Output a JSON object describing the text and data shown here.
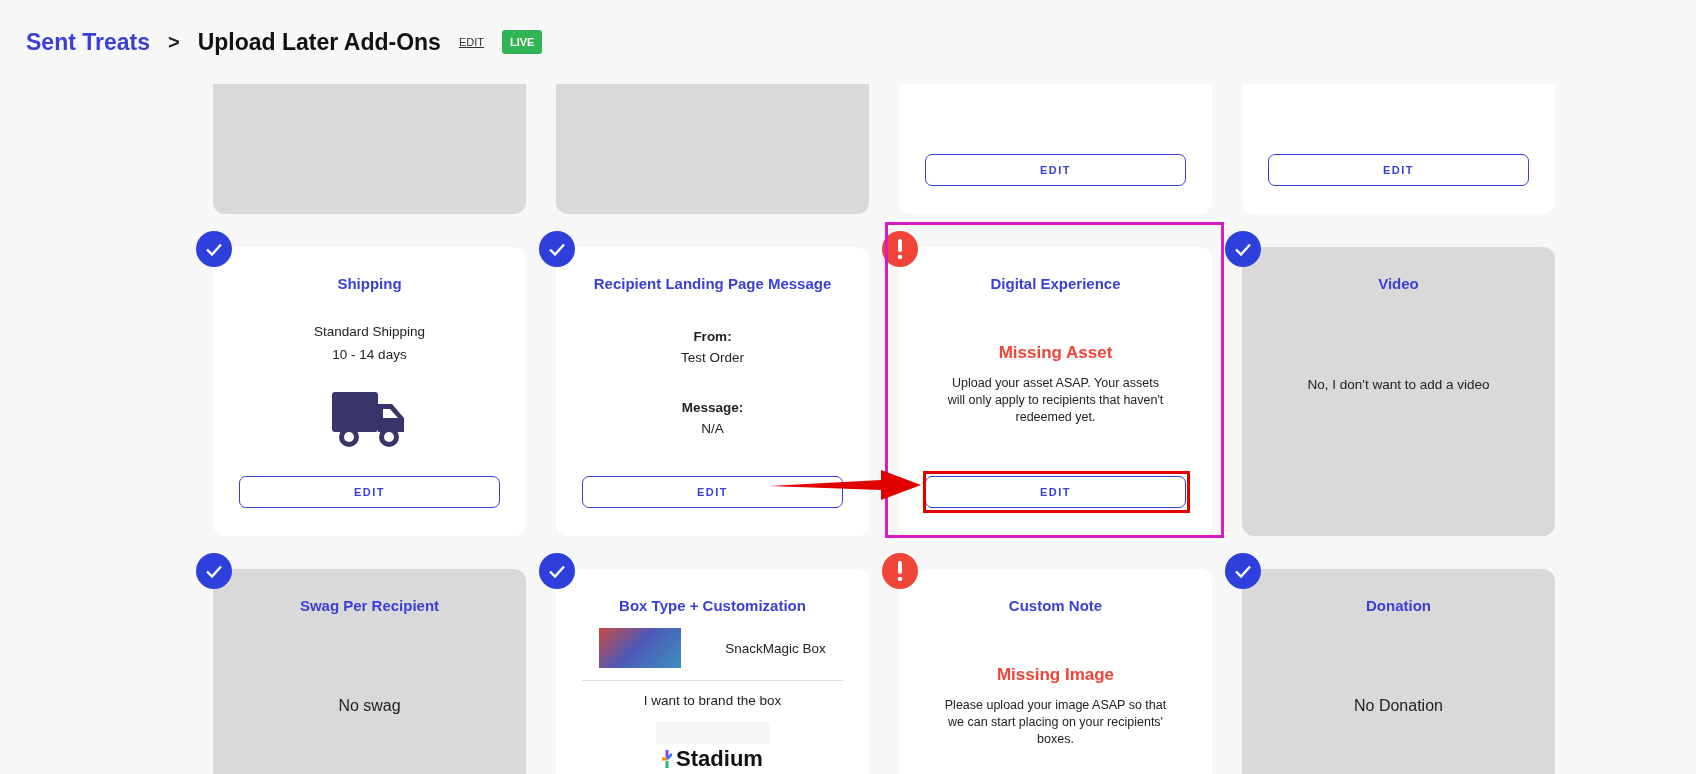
{
  "breadcrumb": {
    "parent": "Sent Treats",
    "separator": ">",
    "current": "Upload Later Add-Ons",
    "edit_link": "EDIT",
    "status_badge": "LIVE"
  },
  "cards": [
    {
      "kind": "blank",
      "enabled": false,
      "annotated": false
    },
    {
      "kind": "blank",
      "enabled": false,
      "annotated": false
    },
    {
      "kind": "blank",
      "enabled": true,
      "annotated": false,
      "button": "EDIT"
    },
    {
      "kind": "blank",
      "enabled": true,
      "annotated": false,
      "button": "EDIT"
    },
    {
      "kind": "shipping",
      "enabled": true,
      "complete": true,
      "annotated": false,
      "title": "Shipping",
      "lines": [
        "Standard Shipping",
        "10 - 14 days"
      ],
      "button": "EDIT"
    },
    {
      "kind": "fields",
      "enabled": true,
      "complete": true,
      "annotated": false,
      "title": "Recipient Landing Page Message",
      "fields": [
        {
          "label": "From:",
          "value": "Test Order"
        },
        {
          "label": "Message:",
          "value": "N/A"
        }
      ],
      "button": "EDIT"
    },
    {
      "kind": "alert",
      "enabled": true,
      "complete": false,
      "annotated": true,
      "title": "Digital Experience",
      "alert": "Missing Asset",
      "message": "Upload your asset ASAP. Your assets will only apply to recipients that haven't redeemed yet.",
      "button": "EDIT"
    },
    {
      "kind": "note",
      "enabled": false,
      "complete": true,
      "annotated": false,
      "title": "Video",
      "note": "No, I don't want to add a video"
    },
    {
      "kind": "note",
      "enabled": false,
      "complete": true,
      "annotated": false,
      "title": "Swag Per Recipient",
      "note": "No swag"
    },
    {
      "kind": "box",
      "enabled": true,
      "complete": true,
      "annotated": false,
      "title": "Box Type + Customization",
      "product": "SnackMagic Box",
      "branding": "I want to brand the box",
      "logo": "Stadium"
    },
    {
      "kind": "alert",
      "enabled": true,
      "complete": false,
      "annotated": false,
      "title": "Custom Note",
      "alert": "Missing Image",
      "message": "Please upload your image ASAP so that we can start placing on your recipients' boxes."
    },
    {
      "kind": "note",
      "enabled": false,
      "complete": true,
      "annotated": false,
      "title": "Donation",
      "note": "No Donation"
    }
  ]
}
